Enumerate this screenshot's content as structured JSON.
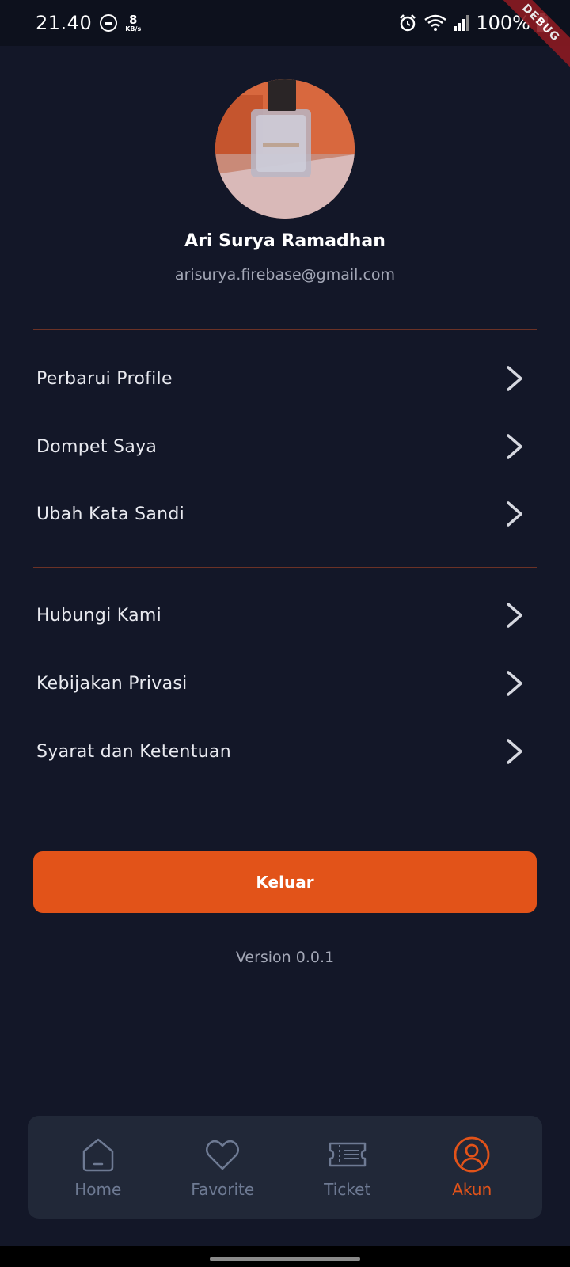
{
  "status_bar": {
    "time": "21.40",
    "net_speed_value": "8",
    "net_speed_unit": "KB/s",
    "battery": "100%",
    "debug_label": "DEBUG"
  },
  "profile": {
    "name": "Ari Surya Ramadhan",
    "email": "arisurya.firebase@gmail.com"
  },
  "menu_group_1": [
    {
      "label": "Perbarui Profile"
    },
    {
      "label": "Dompet Saya"
    },
    {
      "label": "Ubah Kata Sandi"
    }
  ],
  "menu_group_2": [
    {
      "label": "Hubungi Kami"
    },
    {
      "label": "Kebijakan Privasi"
    },
    {
      "label": "Syarat dan Ketentuan"
    }
  ],
  "logout_label": "Keluar",
  "version": "Version 0.0.1",
  "bottom_nav": [
    {
      "label": "Home",
      "icon": "home-icon",
      "active": false
    },
    {
      "label": "Favorite",
      "icon": "heart-icon",
      "active": false
    },
    {
      "label": "Ticket",
      "icon": "ticket-icon",
      "active": false
    },
    {
      "label": "Akun",
      "icon": "account-icon",
      "active": true
    }
  ],
  "colors": {
    "background": "#131728",
    "accent": "#e25319",
    "nav_background": "#212838",
    "inactive": "#6e7a93",
    "divider": "#6b3226"
  }
}
